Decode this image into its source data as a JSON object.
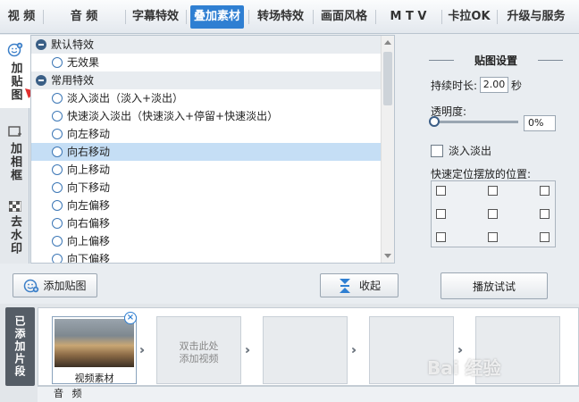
{
  "tabs": [
    "视 频",
    "音 频",
    "字幕特效",
    "叠加素材",
    "转场特效",
    "画面风格",
    "M T V",
    "卡拉OK",
    "升级与服务"
  ],
  "active_tab": "叠加素材",
  "vtabs": {
    "sticker": "加贴图",
    "frame": "加相框",
    "watermark": "去水印"
  },
  "list": {
    "default_group": "默认特效",
    "no_effect": "无效果",
    "common_group": "常用特效",
    "items": [
      "淡入淡出（淡入+淡出）",
      "快速淡入淡出（快速淡入+停留+快速淡出）",
      "向左移动",
      "向右移动",
      "向上移动",
      "向下移动",
      "向左偏移",
      "向右偏移",
      "向上偏移",
      "向下偏移"
    ],
    "selected": "向右移动"
  },
  "settings": {
    "title": "贴图设置",
    "duration_label": "持续时长:",
    "duration_value": "2.00",
    "duration_unit": "秒",
    "opacity_label": "透明度:",
    "opacity_value": "0%",
    "opacity_level": 0,
    "fade_label": "淡入淡出",
    "fade_checked": false,
    "position_label": "快速定位摆放的位置:"
  },
  "buttons": {
    "add_sticker": "添加贴图",
    "collapse": "收起",
    "preview": "播放试试"
  },
  "timeline": {
    "added_label": "已添加片段",
    "clip_caption": "视频素材",
    "empty_hint_line1": "双击此处",
    "empty_hint_line2": "添加视频",
    "audio_label": "音 频"
  },
  "watermark_text": "Bai 经验",
  "colors": {
    "accent": "#2f7fd2",
    "selected_row": "#c5def5",
    "arrow": "#e0302f"
  }
}
